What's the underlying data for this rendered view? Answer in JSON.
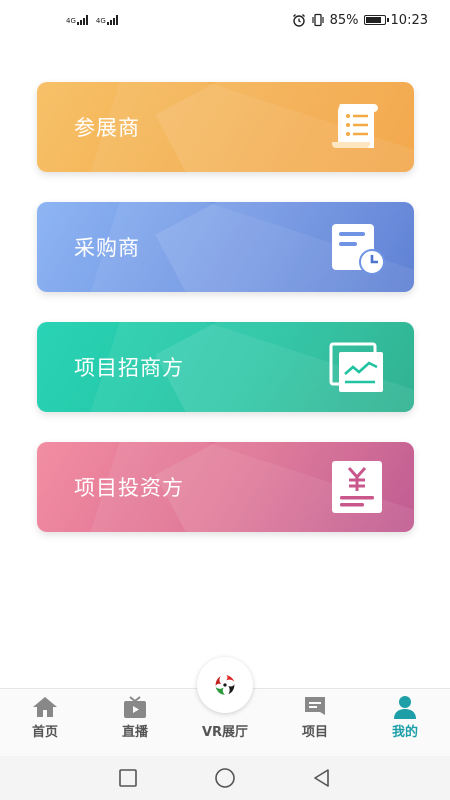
{
  "status_bar": {
    "signal_1": "4G",
    "signal_2": "4G",
    "battery_percent": "85%",
    "battery_level": 0.85,
    "time": "10:23",
    "icons": [
      "alarm-icon",
      "vibrate-icon",
      "battery-icon"
    ]
  },
  "cards": [
    {
      "label": "参展商",
      "icon": "scroll-list-icon",
      "colors": [
        "#f7c169",
        "#f29f3a"
      ]
    },
    {
      "label": "采购商",
      "icon": "document-clock-icon",
      "colors": [
        "#8eb5f3",
        "#4e73cf"
      ]
    },
    {
      "label": "项目招商方",
      "icon": "chart-window-icon",
      "colors": [
        "#2bd3b6",
        "#1aa985"
      ]
    },
    {
      "label": "项目投资方",
      "icon": "yen-document-icon",
      "colors": [
        "#f28ea3",
        "#b94a86"
      ]
    }
  ],
  "tab_bar": {
    "active_color": "#1e9fa8",
    "items": [
      {
        "label": "首页",
        "icon": "home-icon"
      },
      {
        "label": "直播",
        "icon": "tv-icon"
      },
      {
        "label": "VR展厅",
        "icon": "vr-logo-icon"
      },
      {
        "label": "项目",
        "icon": "message-icon"
      },
      {
        "label": "我的",
        "icon": "user-icon",
        "active": true
      }
    ]
  },
  "system_nav": {
    "icons": [
      "square-recents-icon",
      "circle-home-icon",
      "triangle-back-icon"
    ]
  }
}
